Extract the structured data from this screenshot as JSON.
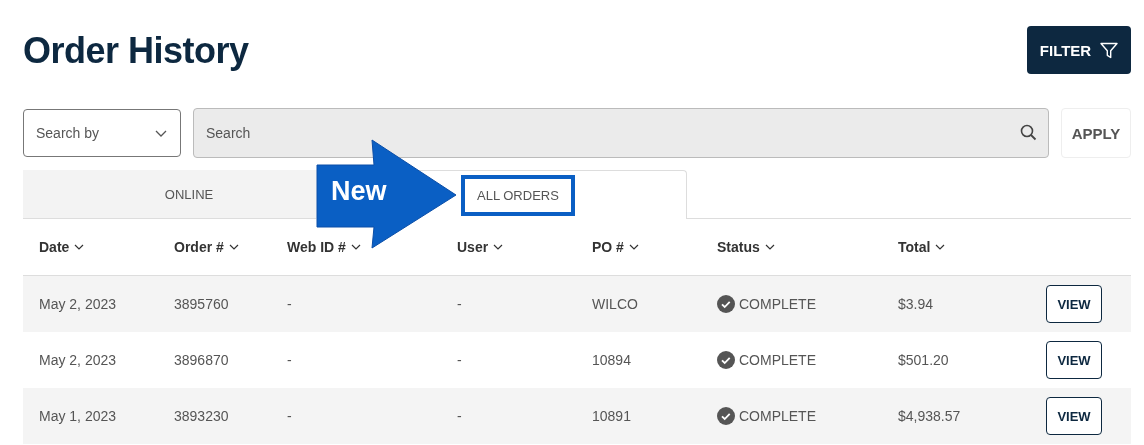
{
  "title": "Order History",
  "filter_button": "FILTER",
  "search_by": {
    "placeholder": "Search by"
  },
  "search": {
    "placeholder": "Search"
  },
  "apply_button": "APPLY",
  "tabs": [
    {
      "label": "ONLINE",
      "selected": false,
      "highlighted": false
    },
    {
      "label": "ALL ORDERS",
      "selected": true,
      "highlighted": true
    }
  ],
  "callout": {
    "label": "New"
  },
  "table": {
    "columns": [
      "Date",
      "Order #",
      "Web ID #",
      "User",
      "PO #",
      "Status",
      "Total"
    ],
    "rows": [
      {
        "date": "May 2, 2023",
        "order": "3895760",
        "web_id": "-",
        "user": "-",
        "po": "WILCO",
        "status": "COMPLETE",
        "total": "$3.94",
        "action": "VIEW"
      },
      {
        "date": "May 2, 2023",
        "order": "3896870",
        "web_id": "-",
        "user": "-",
        "po": "10894",
        "status": "COMPLETE",
        "total": "$501.20",
        "action": "VIEW"
      },
      {
        "date": "May 1, 2023",
        "order": "3893230",
        "web_id": "-",
        "user": "-",
        "po": "10891",
        "status": "COMPLETE",
        "total": "$4,938.57",
        "action": "VIEW"
      }
    ]
  }
}
